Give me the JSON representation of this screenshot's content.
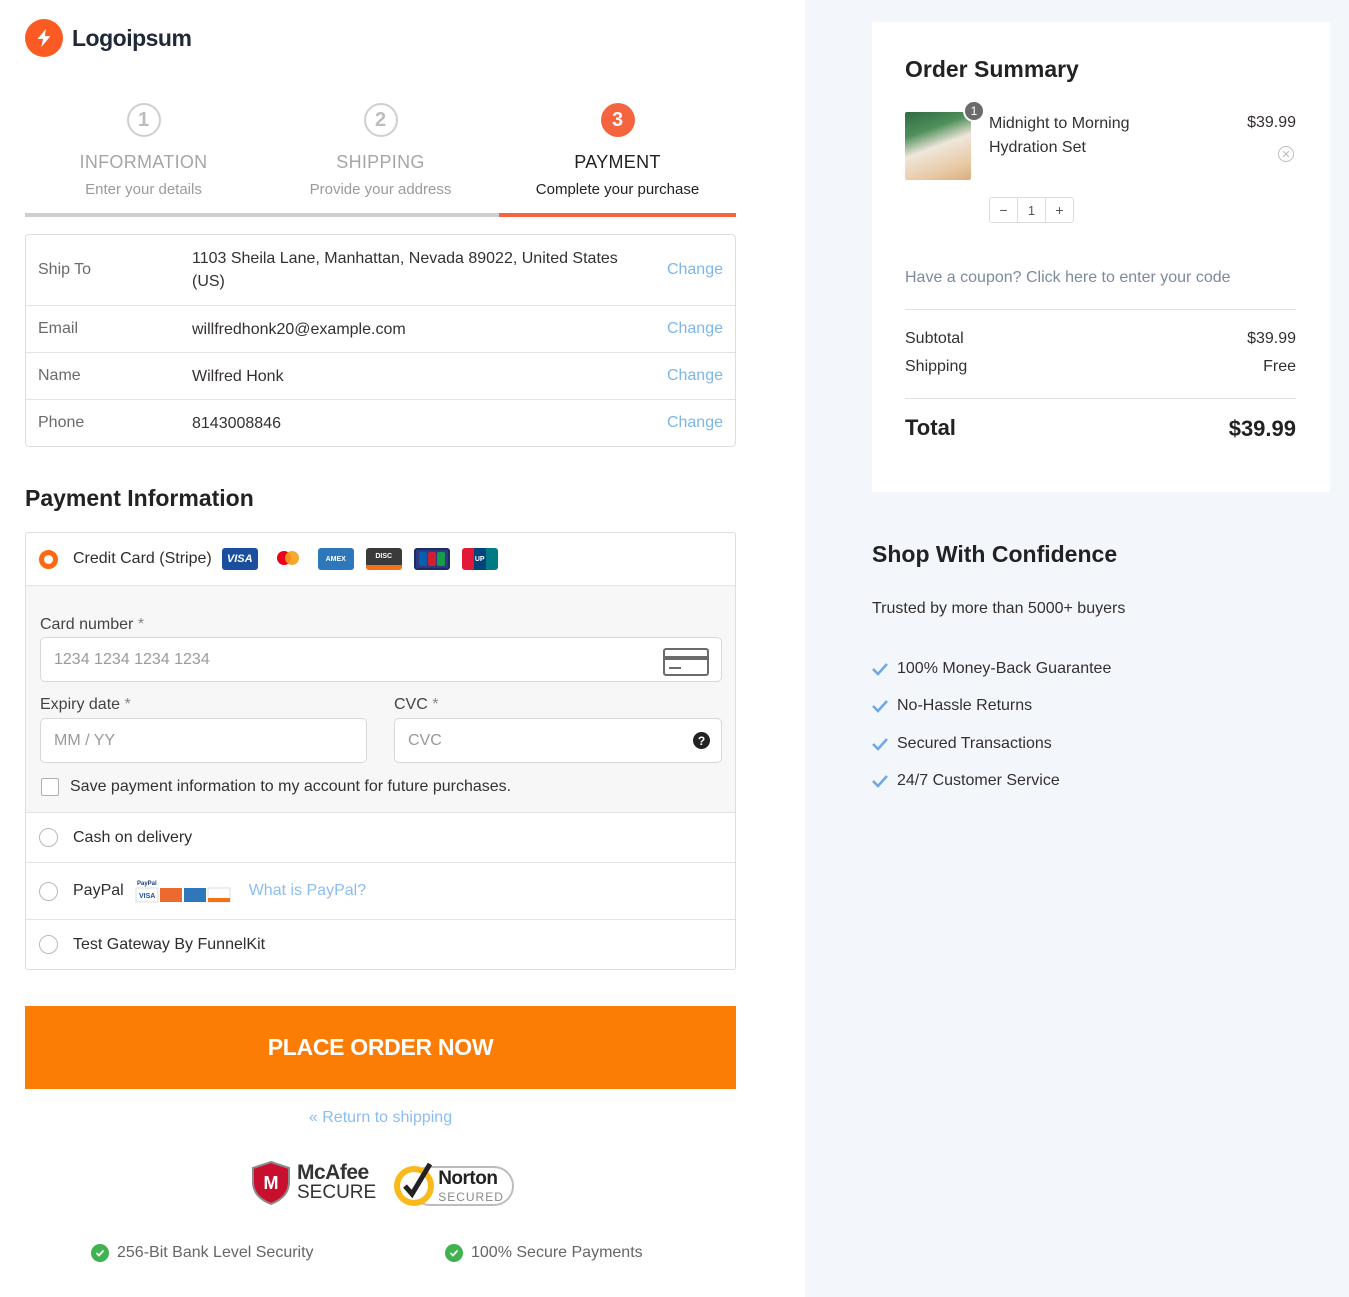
{
  "brand": {
    "name": "Logoipsum",
    "accent": "#fb5a23",
    "button_color": "#fb7d05",
    "link_color": "#7cb6ea"
  },
  "steps": [
    {
      "number": "1",
      "title": "INFORMATION",
      "subtitle": "Enter your details",
      "state": "done"
    },
    {
      "number": "2",
      "title": "SHIPPING",
      "subtitle": "Provide your address",
      "state": "done"
    },
    {
      "number": "3",
      "title": "PAYMENT",
      "subtitle": "Complete your purchase",
      "state": "active"
    }
  ],
  "info_rows": [
    {
      "label": "Ship To",
      "value": "1103 Sheila Lane, Manhattan, Nevada 89022, United States (US)",
      "action": "Change"
    },
    {
      "label": "Email",
      "value": "willfredhonk20@example.com",
      "action": "Change"
    },
    {
      "label": "Name",
      "value": "Wilfred Honk",
      "action": "Change"
    },
    {
      "label": "Phone",
      "value": "8143008846",
      "action": "Change"
    }
  ],
  "payment": {
    "title": "Payment Information",
    "credit_card": {
      "label": "Credit Card (Stripe)",
      "selected": true,
      "card_icons": [
        "visa-icon",
        "mastercard-icon",
        "amex-icon",
        "discover-icon",
        "jcb-icon",
        "unionpay-icon"
      ],
      "card_number_label": "Card number",
      "card_number_placeholder": "1234 1234 1234 1234",
      "expiry_label": "Expiry date",
      "expiry_placeholder": "MM / YY",
      "cvc_label": "CVC",
      "cvc_placeholder": "CVC",
      "required_mark": "*",
      "save_label": "Save payment information to my account for future purchases."
    },
    "cod_label": "Cash on delivery",
    "paypal_label": "PayPal",
    "paypal_link": "What is PayPal?",
    "test_gateway_label": "Test Gateway By FunnelKit"
  },
  "place_order": "PLACE ORDER NOW",
  "return_link": "« Return to shipping",
  "trust_badges": {
    "mcafee_line1": "McAfee",
    "mcafee_line2": "SECURE",
    "norton_line1": "Norton",
    "norton_line2": "SECURED"
  },
  "security": [
    "256-Bit Bank Level Security",
    "100% Secure Payments"
  ],
  "order_summary": {
    "title": "Order Summary",
    "product": {
      "name": "Midnight to Morning Hydration Set",
      "price": "$39.99",
      "qty": "1",
      "minus": "−",
      "plus": "+"
    },
    "coupon_text": "Have a coupon? Click here to enter your code",
    "subtotal_label": "Subtotal",
    "subtotal_value": "$39.99",
    "shipping_label": "Shipping",
    "shipping_value": "Free",
    "total_label": "Total",
    "total_value": "$39.99"
  },
  "confidence": {
    "title": "Shop With Confidence",
    "subtitle": "Trusted by more than 5000+ buyers",
    "items": [
      "100% Money-Back Guarantee",
      "No-Hassle Returns",
      "Secured Transactions",
      "24/7 Customer Service"
    ]
  }
}
